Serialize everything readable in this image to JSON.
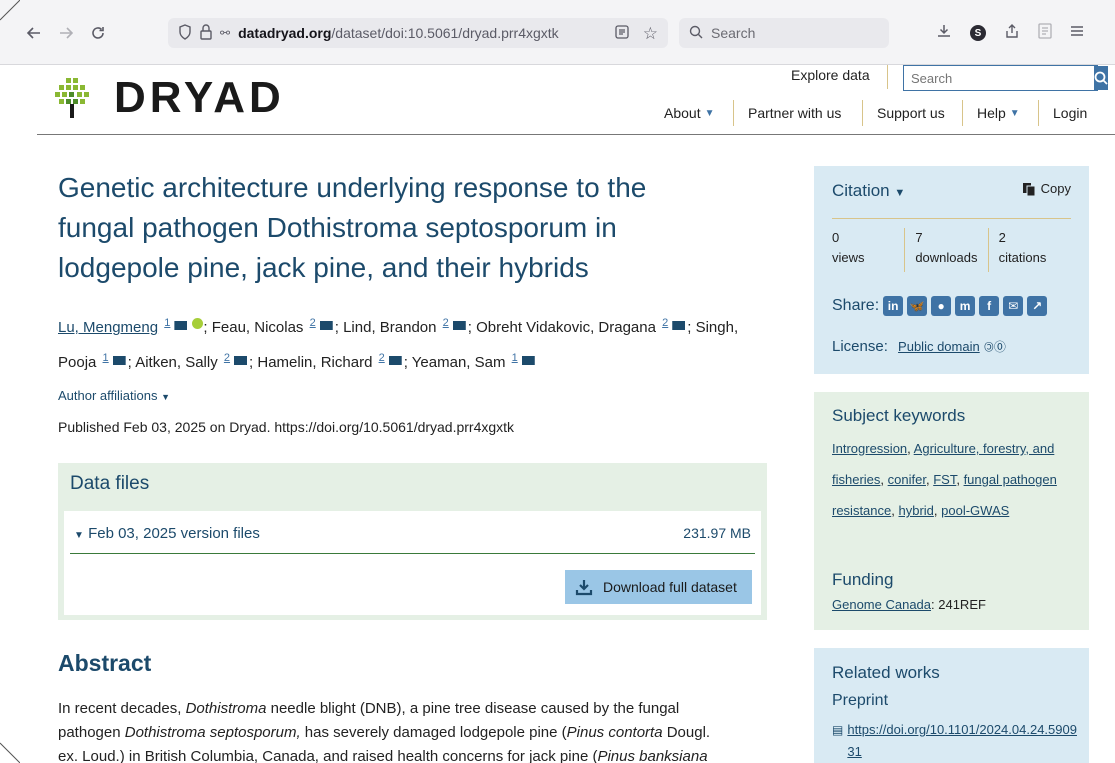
{
  "browser": {
    "url_host": "datadryad.org",
    "url_path": "/dataset/doi:10.5061/dryad.prr4xgxtk",
    "search_placeholder": "Search",
    "profile_initial": "S"
  },
  "site": {
    "logo_text": "DRYAD",
    "explore": "Explore data",
    "search_placeholder": "Search",
    "nav": {
      "about": "About",
      "partner": "Partner with us",
      "support": "Support us",
      "help": "Help",
      "login": "Login"
    }
  },
  "dataset": {
    "title_lines": [
      "Genetic architecture underlying response to the",
      "fungal pathogen Dothistroma septosporum in",
      "lodgepole pine, jack pine, and their hybrids"
    ],
    "authors": [
      {
        "name": "Lu, Mengmeng",
        "aff": "1"
      },
      {
        "name": "Feau, Nicolas",
        "aff": "2"
      },
      {
        "name": "Lind, Brandon",
        "aff": "2"
      },
      {
        "name": "Obreht Vidakovic, Dragana",
        "aff": "2"
      },
      {
        "name": "Singh, Pooja",
        "aff": "1"
      },
      {
        "name": "Aitken, Sally",
        "aff": "2"
      },
      {
        "name": "Hamelin, Richard",
        "aff": "2"
      },
      {
        "name": "Yeaman, Sam",
        "aff": "1"
      }
    ],
    "affiliations_label": "Author affiliations",
    "published": "Published Feb 03, 2025 on Dryad. https://doi.org/10.5061/dryad.prr4xgxtk"
  },
  "data_files": {
    "heading": "Data files",
    "version_label": "Feb 03, 2025 version files",
    "size": "231.97 MB",
    "download_label": "Download full dataset"
  },
  "abstract": {
    "heading": "Abstract",
    "line1_pre": "In recent decades, ",
    "line1_em": "Dothistroma",
    "line1_post": " needle blight (DNB), a pine tree disease caused by the fungal",
    "line2_pre": "pathogen ",
    "line2_em": "Dothistroma septosporum,",
    "line2_mid": " has severely damaged lodgepole pine (",
    "line2_em2": "Pinus contorta",
    "line2_post": " Dougl.",
    "line3_pre": "ex. Loud.) in British Columbia, Canada, and raised health concerns for jack pine (",
    "line3_em": "Pinus banksiana"
  },
  "citation": {
    "heading": "Citation",
    "copy": "Copy",
    "stats": [
      {
        "value": "0",
        "label": "views"
      },
      {
        "value": "7",
        "label": "downloads"
      },
      {
        "value": "2",
        "label": "citations"
      }
    ],
    "share_label": "Share:",
    "license_label": "License:",
    "license_value": "Public domain"
  },
  "keywords": {
    "heading": "Subject keywords",
    "items": [
      "Introgression",
      "Agriculture, forestry, and fisheries",
      "conifer",
      "FST",
      "fungal pathogen resistance",
      "hybrid",
      "pool-GWAS"
    ]
  },
  "funding": {
    "heading": "Funding",
    "funder": "Genome Canada",
    "award": ": 241REF"
  },
  "related": {
    "heading": "Related works",
    "sub": "Preprint",
    "link": "https://doi.org/10.1101/2024.04.24.590931"
  }
}
